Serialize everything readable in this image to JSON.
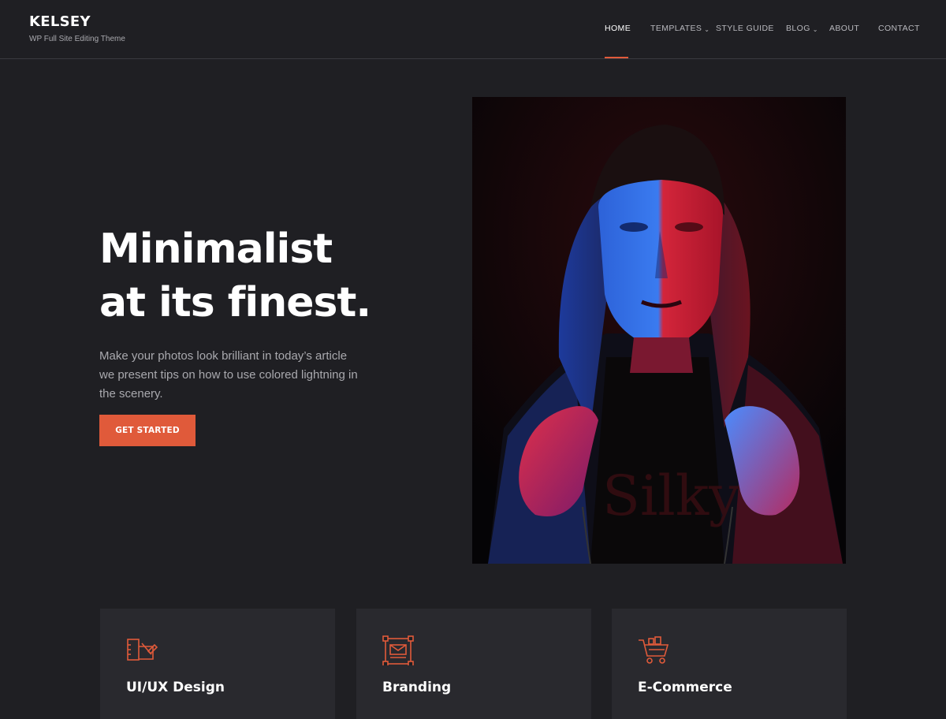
{
  "site": {
    "title": "KELSEY",
    "tagline": "WP Full Site Editing Theme"
  },
  "nav": {
    "items": [
      {
        "label": "HOME",
        "active": true,
        "has_dropdown": false
      },
      {
        "label": "TEMPLATES",
        "active": false,
        "has_dropdown": true
      },
      {
        "label": "STYLE GUIDE",
        "active": false,
        "has_dropdown": false
      },
      {
        "label": "BLOG",
        "active": false,
        "has_dropdown": true
      },
      {
        "label": "ABOUT",
        "active": false,
        "has_dropdown": false
      },
      {
        "label": "CONTACT",
        "active": false,
        "has_dropdown": false
      }
    ],
    "dropdown_icon": "chevron-down-icon"
  },
  "hero": {
    "title_line1": "Minimalist",
    "title_line2": "at its finest.",
    "description": "Make your photos look brilliant in today’s article we present tips on how to use colored lightning in the scenery.",
    "cta_label": "GET STARTED",
    "image_alt": "Portrait of a man in a hooded jacket lit with blue and red light"
  },
  "services": [
    {
      "title": "UI/UX Design",
      "icon": "design-tools-icon"
    },
    {
      "title": "Branding",
      "icon": "branding-board-icon"
    },
    {
      "title": "E-Commerce",
      "icon": "shopping-cart-icon"
    }
  ],
  "colors": {
    "background": "#1f1f23",
    "card": "#29292e",
    "accent": "#e05a3a",
    "text_muted": "#a9a9ae"
  }
}
